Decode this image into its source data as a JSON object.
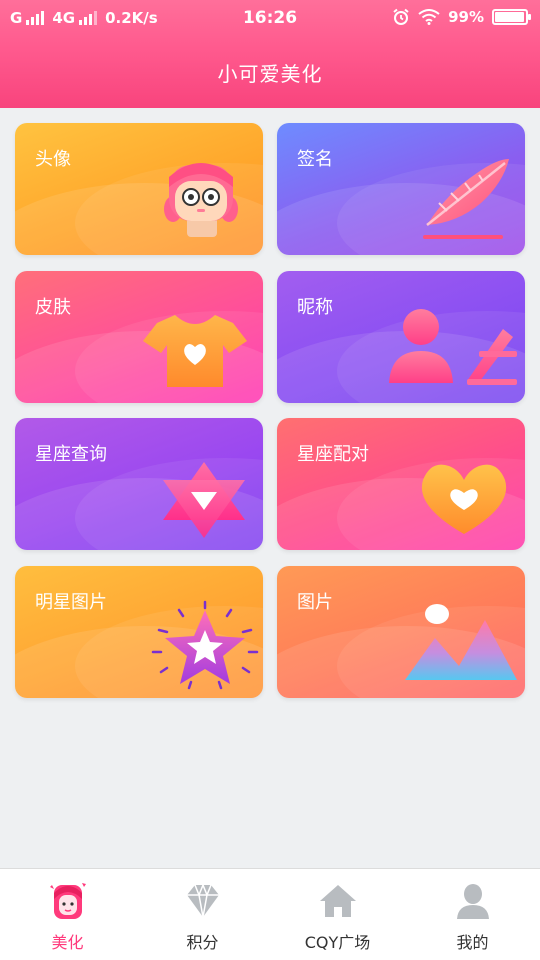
{
  "status_bar": {
    "carrier": "G",
    "network": "4G",
    "speed": "0.2K/s",
    "time": "16:26",
    "battery": "99%",
    "icons": [
      "signal-icon",
      "alarm-icon",
      "wifi-icon",
      "battery-icon"
    ]
  },
  "header": {
    "title": "小可爱美化"
  },
  "cards": [
    {
      "label": "头像",
      "icon": "girl-avatar-icon"
    },
    {
      "label": "签名",
      "icon": "feather-pen-icon"
    },
    {
      "label": "皮肤",
      "icon": "tshirt-heart-icon"
    },
    {
      "label": "昵称",
      "icon": "person-pen-icon"
    },
    {
      "label": "星座查询",
      "icon": "hexagram-star-icon"
    },
    {
      "label": "星座配对",
      "icon": "heart-icon"
    },
    {
      "label": "明星图片",
      "icon": "star-badge-icon"
    },
    {
      "label": "图片",
      "icon": "landscape-image-icon"
    }
  ],
  "bottom_nav": [
    {
      "label": "美化",
      "icon": "girl-face-icon",
      "active": true
    },
    {
      "label": "积分",
      "icon": "diamond-icon",
      "active": false
    },
    {
      "label": "CQY广场",
      "icon": "home-icon",
      "active": false
    },
    {
      "label": "我的",
      "icon": "user-icon",
      "active": false
    }
  ],
  "colors": {
    "accent": "#ff3a7c",
    "header": "#ff5a8e",
    "inactive_icon": "#b8bcc0"
  }
}
